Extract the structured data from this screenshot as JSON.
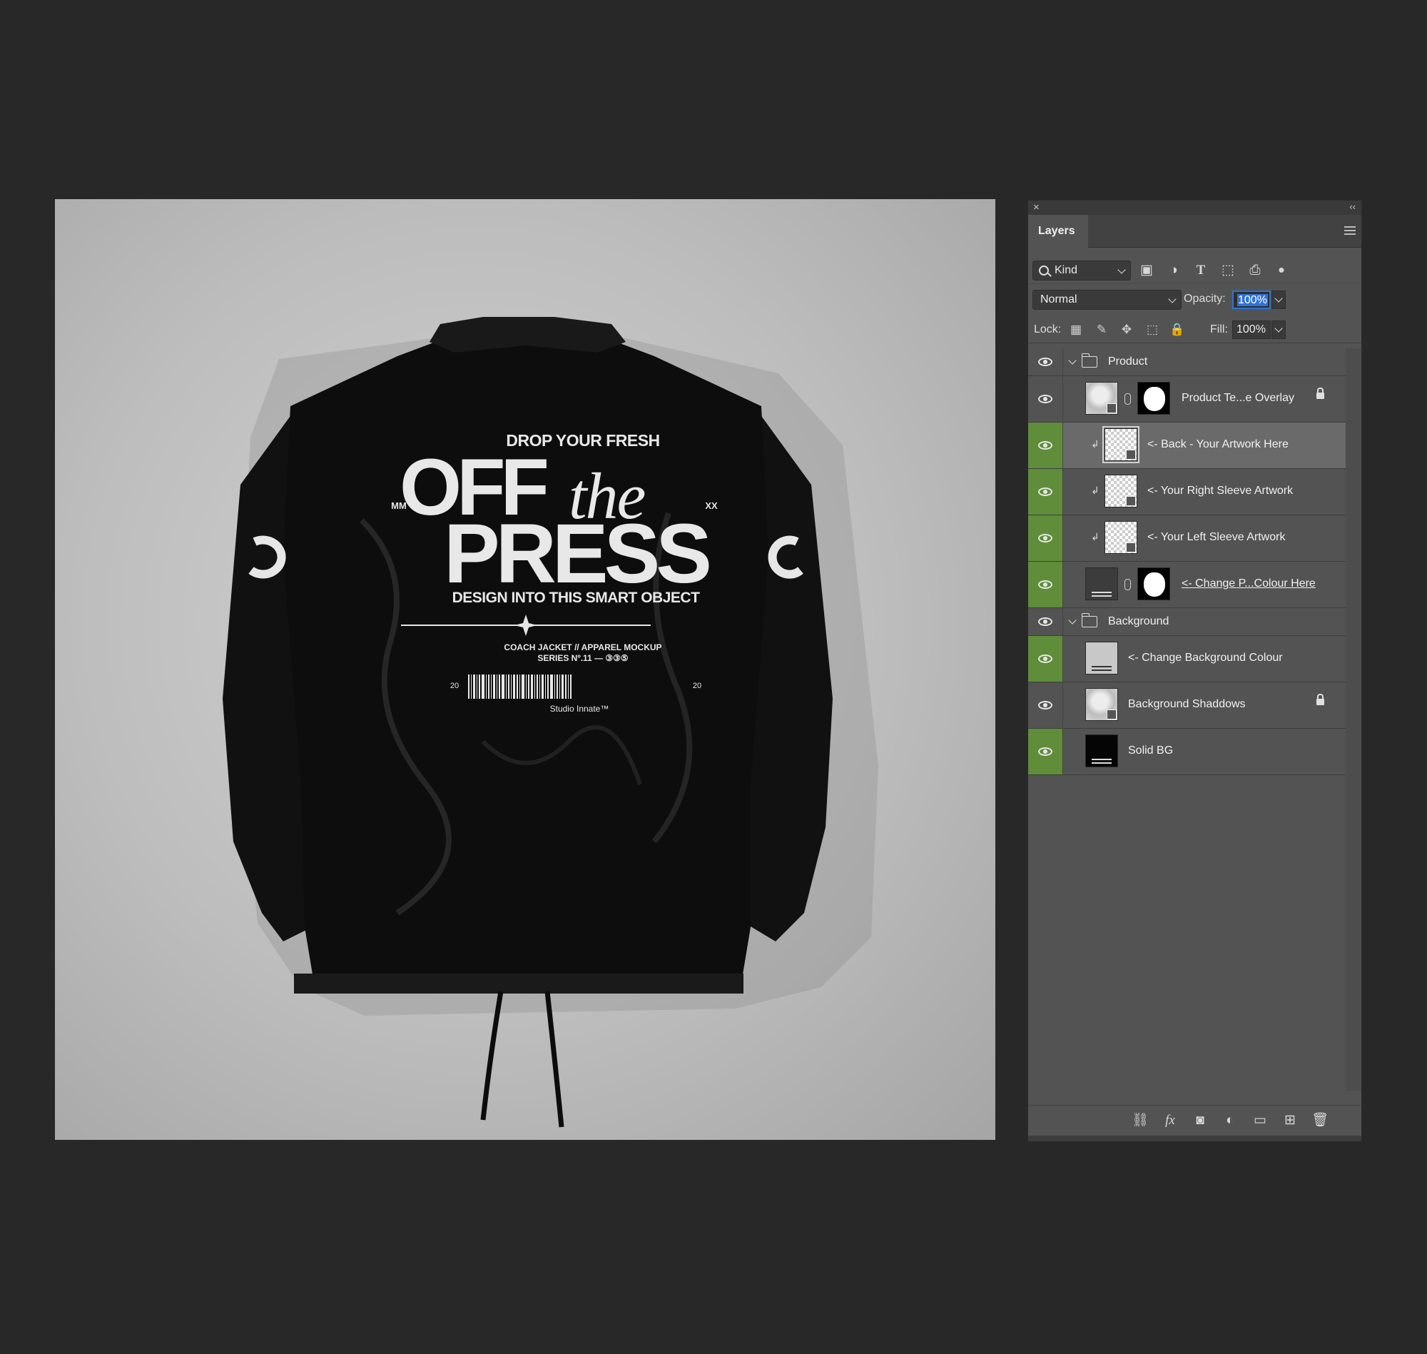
{
  "mockup": {
    "headline_top": "DROP YOUR FRESH",
    "headline_off": "OFF",
    "headline_the": "the",
    "headline_press": "PRESS",
    "corner_left": "MM",
    "corner_right": "XX",
    "subline": "DESIGN INTO THIS SMART OBJECT",
    "caption_line1": "COACH JACKET // APPAREL MOCKUP",
    "caption_line2": "SERIES Nº.11 — ③③⑤",
    "barcode_left": "20",
    "barcode_right": "20",
    "studio": "Studio Innate™"
  },
  "panel": {
    "tab": "Layers",
    "filter_kind": "Kind",
    "blend_mode": "Normal",
    "opacity_label": "Opacity:",
    "opacity_value": "100%",
    "lock_label": "Lock:",
    "fill_label": "Fill:",
    "fill_value": "100%",
    "filter_icons": [
      "image-filter-icon",
      "adjustment-filter-icon",
      "type-filter-icon",
      "shape-filter-icon",
      "smart-object-filter-icon",
      "filter-toggle-icon"
    ],
    "lock_icons": [
      "lock-transparent-icon",
      "lock-paint-icon",
      "lock-position-icon",
      "lock-artboard-icon",
      "lock-all-icon"
    ],
    "bottom_icons": [
      "link-layers-icon",
      "fx-icon",
      "add-mask-icon",
      "adjustment-layer-icon",
      "new-group-icon",
      "new-layer-icon",
      "trash-icon"
    ]
  },
  "layers": [
    {
      "name": "Product",
      "kind": "group"
    },
    {
      "name": "Product Te...e Overlay",
      "kind": "smart",
      "locked": true
    },
    {
      "name": "<- Back - Your Artwork Here",
      "kind": "clip",
      "selected": true
    },
    {
      "name": "<- Your Right Sleeve Artwork",
      "kind": "clip"
    },
    {
      "name": "<- Your Left Sleeve Artwork",
      "kind": "clip"
    },
    {
      "name": "<- Change P...Colour Here",
      "kind": "fill-mask"
    },
    {
      "name": "Background",
      "kind": "group"
    },
    {
      "name": "<- Change Background Colour",
      "kind": "fill"
    },
    {
      "name": "Background Shaddows",
      "kind": "smart",
      "locked": true
    },
    {
      "name": "Solid BG",
      "kind": "fill"
    }
  ],
  "colors": {
    "app_background": "#282828",
    "panel_background": "#535353",
    "visibility_highlight": "#5f8d3a",
    "selection_blue": "#2f74d6"
  }
}
